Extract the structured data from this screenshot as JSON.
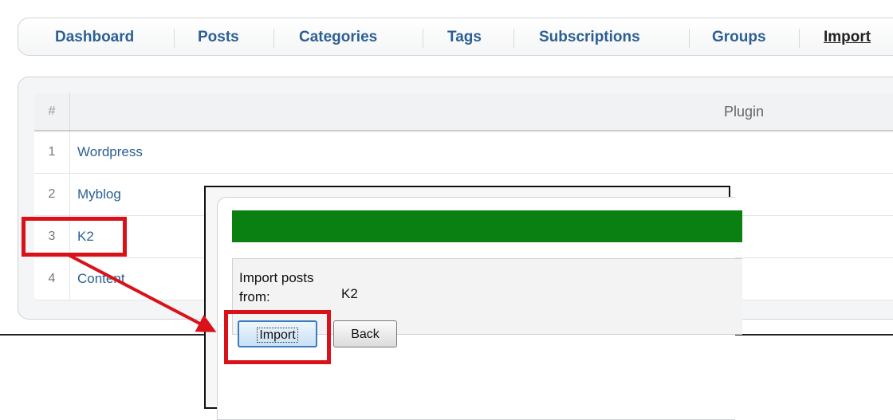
{
  "nav": {
    "items": [
      {
        "label": "Dashboard"
      },
      {
        "label": "Posts"
      },
      {
        "label": "Categories"
      },
      {
        "label": "Tags"
      },
      {
        "label": "Subscriptions"
      },
      {
        "label": "Groups"
      },
      {
        "label": "Import",
        "active": true
      }
    ]
  },
  "table": {
    "headers": {
      "num": "#",
      "plugin": "Plugin"
    },
    "rows": [
      {
        "num": "1",
        "name": "Wordpress"
      },
      {
        "num": "2",
        "name": "Myblog"
      },
      {
        "num": "3",
        "name": "K2"
      },
      {
        "num": "4",
        "name": "Content"
      }
    ]
  },
  "dialog": {
    "progress_fraction": 1.0,
    "progress_color": "#0a8012",
    "import_label": "Import posts from:",
    "import_value": "K2",
    "import_button": "Import",
    "back_button": "Back"
  },
  "annotation": {
    "highlight_color": "#d9121a",
    "arrow_color": "#d9121a",
    "arrow_icon": "arrow-icon"
  }
}
